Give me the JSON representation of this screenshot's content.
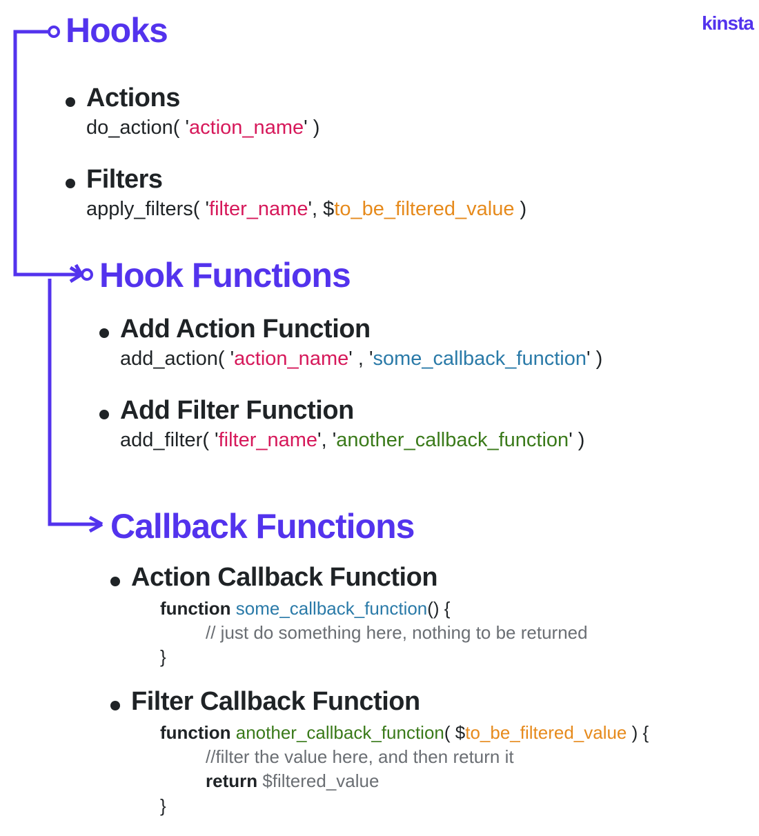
{
  "logo": "KINSTa",
  "sections": {
    "hooks": {
      "title": "Hooks",
      "actions": {
        "label": "Actions",
        "fn": "do_action",
        "open": "( '",
        "arg1": "action_name",
        "close": "' )"
      },
      "filters": {
        "label": "Filters",
        "fn": "apply_filters",
        "open": "( '",
        "arg1": "filter_name",
        "mid": "', $",
        "arg2": "to_be_filtered_value",
        "close": " )"
      }
    },
    "hookfns": {
      "title": "Hook Functions",
      "addAction": {
        "label": "Add Action Function",
        "fn": "add_action",
        "open": "( '",
        "arg1": "action_name",
        "mid": "' , '",
        "arg2": "some_callback_function",
        "close": "' )"
      },
      "addFilter": {
        "label": "Add Filter Function",
        "fn": "add_filter",
        "open": "( '",
        "arg1": "filter_name",
        "mid": "', '",
        "arg2": "another_callback_function",
        "close": "' )"
      }
    },
    "callbacks": {
      "title": "Callback Functions",
      "actionCb": {
        "label": "Action Callback Function",
        "kw": "function ",
        "name": "some_callback_function",
        "sig": "() {",
        "comment": "// just do something here, nothing to be returned",
        "close": "}"
      },
      "filterCb": {
        "label": "Filter Callback Function",
        "kw": "function ",
        "name": "another_callback_function",
        "sigOpen": "( $",
        "param": "to_be_filtered_value",
        "sigClose": " ) {",
        "comment": "//filter the value here, and then return it",
        "retKw": "return ",
        "retVal": "$filtered_value",
        "close": "}"
      }
    }
  }
}
